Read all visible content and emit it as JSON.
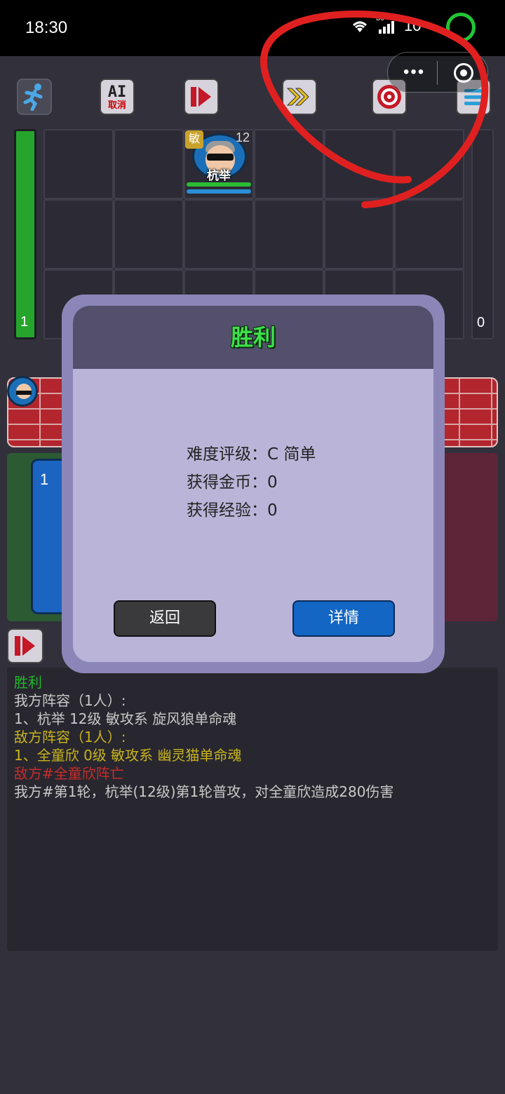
{
  "status_bar": {
    "time": "18:30",
    "signal_label": "39",
    "battery": "10"
  },
  "mini_program_capsule": {
    "more": "•••"
  },
  "toolbar": {
    "ai_top": "AI",
    "ai_bottom": "取消"
  },
  "arena": {
    "left_hp_value": "1",
    "right_hp_value": "0",
    "hero": {
      "name": "杭举",
      "class_badge": "敏",
      "level": "12"
    }
  },
  "card": {
    "number": "1"
  },
  "result_dialog": {
    "title": "胜利",
    "lines": [
      "难度评级：C 简单",
      "获得金币：0",
      "获得经验：0"
    ],
    "back_label": "返回",
    "detail_label": "详情"
  },
  "battle_log": [
    {
      "text": "胜利",
      "color": "#23b62c"
    },
    {
      "text": "我方阵容（1人）:",
      "color": "#c9c9c9"
    },
    {
      "text": "1、杭举 12级 敏攻系 旋风狼单命魂",
      "color": "#c9c9c9"
    },
    {
      "text": "敌方阵容（1人）:",
      "color": "#c8b41c"
    },
    {
      "text": "1、全童欣 0级 敏攻系 幽灵猫单命魂",
      "color": "#c8b41c"
    },
    {
      "text": "敌方#全童欣阵亡",
      "color": "#c62c2c"
    },
    {
      "text": "我方#第1轮，杭举(12级)第1轮普攻，对全童欣造成280伤害",
      "color": "#c9c9c9"
    }
  ],
  "colors": {
    "victory_green": "#3ee04a",
    "annotation_red": "#e02020"
  }
}
